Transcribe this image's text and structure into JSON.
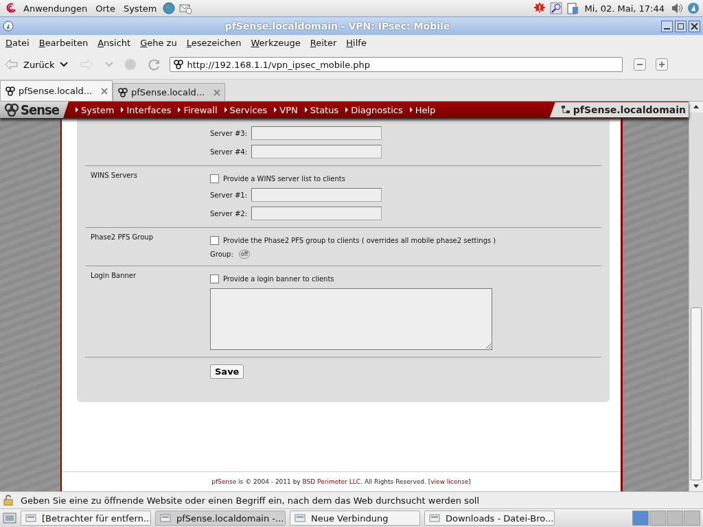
{
  "top_panel": {
    "menus": [
      "Anwendungen",
      "Orte",
      "System"
    ],
    "clock": "Mi, 02. Mai, 17:44"
  },
  "window": {
    "title": "pfSense.localdomain - VPN: IPsec: Mobile"
  },
  "menubar": [
    "Datei",
    "Bearbeiten",
    "Ansicht",
    "Gehe zu",
    "Lesezeichen",
    "Werkzeuge",
    "Reiter",
    "Hilfe"
  ],
  "toolbar": {
    "back": "Zurück",
    "url": "http://192.168.1.1/vpn_ipsec_mobile.php"
  },
  "tabs": [
    {
      "label": "pfSense.locald...",
      "selected": true
    },
    {
      "label": "pfSense.locald...",
      "selected": false
    }
  ],
  "nav": {
    "logo": "Sense",
    "items": [
      "System",
      "Interfaces",
      "Firewall",
      "Services",
      "VPN",
      "Status",
      "Diagnostics",
      "Help"
    ],
    "host": "pfSense.localdomain"
  },
  "sections": [
    {
      "servers": [
        "Server #3:",
        "Server #4:"
      ]
    },
    {
      "label": "WINS Servers",
      "option": {
        "text": "Provide a WINS server list to clients",
        "checked": false
      },
      "servers": [
        "Server #1:",
        "Server #2:"
      ]
    },
    {
      "label": "Phase2 PFS Group",
      "option": {
        "text": "Provide the Phase2 PFS group to clients ( overrides all mobile phase2 settings )",
        "checked": false
      },
      "group": {
        "label": "Group:",
        "value": "off"
      }
    },
    {
      "label": "Login Banner",
      "option": {
        "text": "Provide a login banner to clients",
        "checked": false
      },
      "banner": true
    }
  ],
  "save": "Save",
  "footer": {
    "brand": "pfSense",
    "text": "is © 2004 - 2011 by",
    "company": "BSD Perimeter LLC",
    "rights": ". All Rights Reserved. [",
    "link": "view license",
    "end": "]"
  },
  "status_bar": "Geben Sie eine zu öffnende Website oder einen Begriff ein, nach dem das Web durchsucht werden soll",
  "taskbar": [
    {
      "label": "[Betrachter für entfern...",
      "selected": false
    },
    {
      "label": "pfSense.localdomain -...",
      "selected": true
    },
    {
      "label": "Neue Verbindung",
      "selected": false
    },
    {
      "label": "Downloads - Datei-Bro...",
      "selected": false
    }
  ]
}
